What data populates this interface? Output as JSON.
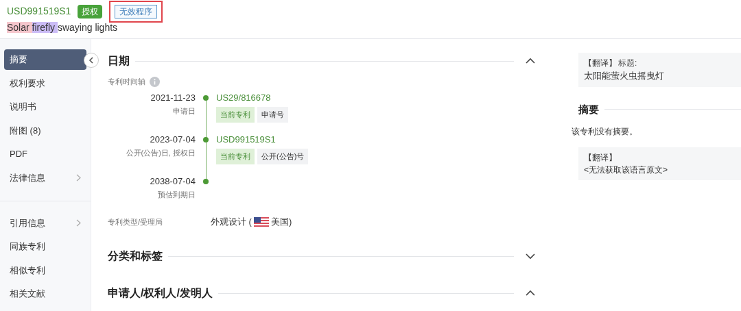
{
  "header": {
    "patent_number": "USD991519S1",
    "status_badge": "授权",
    "procedure_tag": "无效程序",
    "procedure_flagged": true,
    "title_segments": [
      {
        "text": "Solar",
        "color": "#f5c6cc"
      },
      {
        "text": "firefly",
        "color": "#cbbcf6"
      },
      {
        "text": "swaying lights"
      }
    ]
  },
  "sidebar": {
    "groups": [
      [
        {
          "label": "摘要",
          "selected": true,
          "has_submenu": false
        },
        {
          "label": "权利要求",
          "selected": false,
          "has_submenu": false
        },
        {
          "label": "说明书",
          "selected": false,
          "has_submenu": false
        },
        {
          "label": "附图 (8)",
          "selected": false,
          "has_submenu": false
        },
        {
          "label": "PDF",
          "selected": false,
          "has_submenu": false
        },
        {
          "label": "法律信息",
          "selected": false,
          "has_submenu": true
        }
      ],
      [
        {
          "label": "引用信息",
          "selected": false,
          "has_submenu": true
        },
        {
          "label": "同族专利",
          "selected": false,
          "has_submenu": false
        },
        {
          "label": "相似专利",
          "selected": false,
          "has_submenu": false
        },
        {
          "label": "相关文献",
          "selected": false,
          "has_submenu": false
        }
      ]
    ]
  },
  "sections": [
    {
      "title": "日期",
      "expanded": true
    },
    {
      "title": "分类和标签",
      "expanded": false
    },
    {
      "title": "申请人/权利人/发明人",
      "expanded": true
    }
  ],
  "dates": {
    "timeline_label": "专利时间轴",
    "timeline": [
      {
        "date": "2021-11-23",
        "caption": "申请日",
        "number": "US29/816678",
        "tags": [
          {
            "text": "当前专利",
            "kind": "current"
          },
          {
            "text": "申请号",
            "kind": "type"
          }
        ]
      },
      {
        "date": "2023-07-04",
        "caption": "公开(公告)日, 授权日",
        "number": "USD991519S1",
        "tags": [
          {
            "text": "当前专利",
            "kind": "current"
          },
          {
            "text": "公开(公告)号",
            "kind": "type"
          }
        ]
      },
      {
        "date": "2038-07-04",
        "caption": "预估到期日"
      }
    ],
    "patent_type_label": "专利类型/受理局",
    "patent_type": "外观设计 (",
    "office": "美国)"
  },
  "right_panel": {
    "title_translation": {
      "label": "【翻译】",
      "field": "标题:",
      "text": "太阳能萤火虫摇曳灯"
    },
    "abstract_heading": "摘要",
    "abstract_text": "该专利没有摘要。",
    "abstract_translation": {
      "label": "【翻译】",
      "text": "<无法获取该语言原文>"
    }
  }
}
